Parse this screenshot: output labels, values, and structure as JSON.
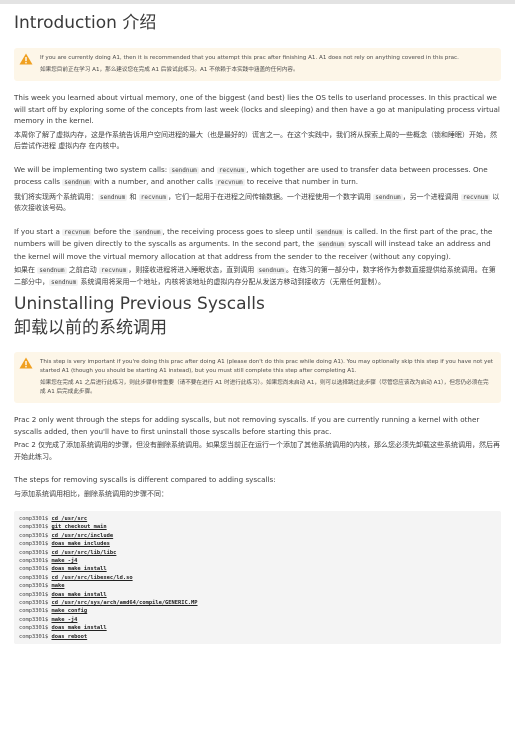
{
  "intro": {
    "heading": "Introduction  介绍",
    "warning_en": "If you are currently doing A1, then it is recommended that you attempt this prac after finishing A1. A1 does not rely on anything covered in this prac.",
    "warning_zh": "如果您目前正在学习 A1，那么建议您在完成 A1 后尝试此练习。A1 不依赖于本实践中涵盖的任何内容。",
    "p1_en": "This week you learned about virtual memory, one of the biggest (and best) lies the OS tells to userland processes. In this practical we will start off by exploring some of the concepts from last week (locks and sleeping) and then have a go at manipulating process virtual memory in the kernel.",
    "p1_zh": "本周你了解了虚拟内存，这是作系统告诉用户空间进程的最大（也是最好的）谎言之一。在这个实践中，我们将从探索上周的一些概念（锁和睡眠）开始，然后尝试作进程 虚拟内存 在内核中。",
    "p2_en": {
      "a": "We will be implementing two system calls: ",
      "c1": "sendnum",
      "b": " and ",
      "c2": "recvnum",
      "c": ", which together are used to transfer data between processes. One process calls ",
      "c3": "sendnum",
      "d": " with a number, and another calls ",
      "c4": "recvnum",
      "e": " to receive that number in turn."
    },
    "p2_zh": {
      "a": "我们将实现两个系统调用：",
      "c1": "sendnum",
      "b": " 和 ",
      "c2": "recvnum",
      "c": "，它们一起用于在进程之间传输数据。一个进程使用一个数字调用 ",
      "c3": "sendnum",
      "d": "，另一个进程调用 ",
      "c4": "recvnum",
      "e": " 以依次接收该号码。"
    },
    "p3_en": {
      "a": "If you start a ",
      "c1": "recvnum",
      "b": " before the ",
      "c2": "sendnum",
      "c": ", the receiving process goes to sleep until ",
      "c3": "sendnum",
      "d": " is called. In the first part of the prac, the numbers will be given directly to the syscalls as arguments. In the second part, the ",
      "c4": "sendnum",
      "e": " syscall will instead take an address and the kernel will move the virtual memory allocation at that address from the sender to the receiver (without any copying)."
    },
    "p3_zh": {
      "a": "如果在 ",
      "c1": "sendnum",
      "b": " 之前启动 ",
      "c2": "recvnum",
      "c": "，则接收进程将进入睡眠状态，直到调用 ",
      "c3": "sendnum",
      "d": "。在练习的第一部分中，数字将作为参数直接提供给系统调用。在第二部分中，",
      "c4": "sendnum",
      "e": " 系统调用将采用一个地址，内核将该地址的虚拟内存分配从发送方移动到接收方（无需任何复制）。"
    }
  },
  "uninstall": {
    "heading_en": "Uninstalling Previous Syscalls",
    "heading_zh": "卸载以前的系统调用",
    "warning_en": "This step is very important if you're doing this prac after doing A1 (please don't do this prac while doing A1). You may optionally skip this step if you have not yet started A1 (though you should be starting A1 instead), but you must still complete this step after completing A1.",
    "warning_zh": "如果您在完成 A1 之后进行此练习，则此步骤非常重要（请不要在进行 A1 时进行此练习）。如果您尚未启动 A1，则可以选择跳过此步骤（尽管您应该改为启动 A1），但您仍必须在完成 A1 后完成此步骤。",
    "p1_en": "Prac 2 only went through the steps for adding syscalls, but not removing syscalls. If you are currently running a kernel with other syscalls added, then you'll have to first uninstall those syscalls before starting this prac.",
    "p1_zh": "Prac 2 仅完成了添加系统调用的步骤，但没有删除系统调用。如果您当前正在运行一个添加了其他系统调用的内核，那么您必须先卸载这些系统调用，然后再开始此练习。",
    "p2_en": "The steps for removing syscalls is different compared to adding syscalls:",
    "p2_zh": "与添加系统调用相比，删除系统调用的步骤不同：",
    "prompt": "comp3301$",
    "commands": [
      "cd /usr/src",
      "git checkout main",
      "cd /usr/src/include",
      "doas make includes",
      "cd /usr/src/lib/libc",
      "make -j4",
      "doas make install",
      "cd /usr/src/libexec/ld.so",
      "make",
      "doas make install",
      "cd /usr/src/sys/arch/amd64/compile/GENERIC.MP",
      "make config",
      "make -j4",
      "doas make install",
      "doas reboot"
    ]
  },
  "colors": {
    "warning_bg": "#fdf6e8",
    "warning_icon": "#f0a020",
    "code_bg": "#f4f4f4"
  }
}
